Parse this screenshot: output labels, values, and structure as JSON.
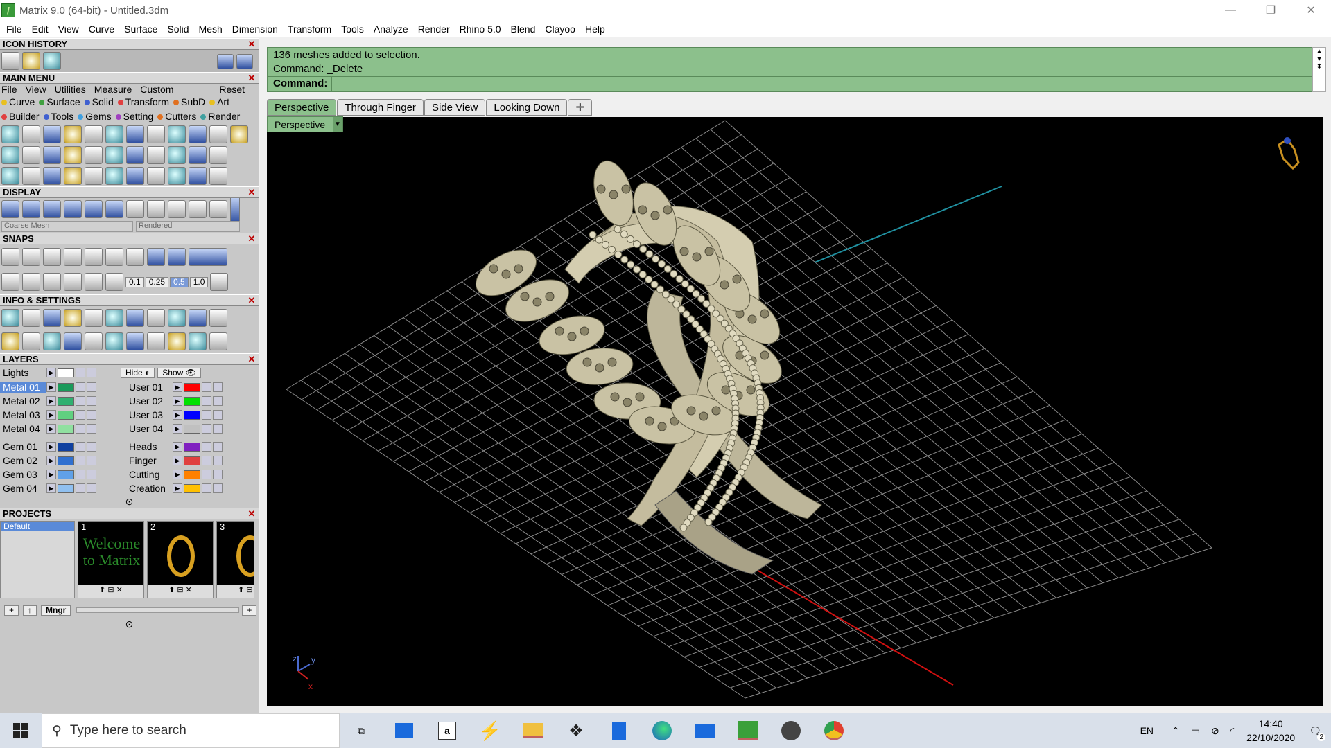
{
  "window": {
    "title": "Matrix 9.0 (64-bit) - Untitled.3dm"
  },
  "menu": [
    "File",
    "Edit",
    "View",
    "Curve",
    "Surface",
    "Solid",
    "Mesh",
    "Dimension",
    "Transform",
    "Tools",
    "Analyze",
    "Render",
    "Rhino 5.0",
    "Blend",
    "Clayoo",
    "Help"
  ],
  "panels": {
    "icon_history": "ICON HISTORY",
    "main_menu": "MAIN MENU",
    "display": "DISPLAY",
    "snaps": "SNAPS",
    "info": "INFO & SETTINGS",
    "layers": "LAYERS",
    "projects": "PROJECTS"
  },
  "main_menu": {
    "tabs": [
      "File",
      "View",
      "Utilities",
      "Measure",
      "Custom"
    ],
    "reset": "Reset",
    "row1": [
      {
        "label": "Curve",
        "color": "#e8c020"
      },
      {
        "label": "Surface",
        "color": "#40a040"
      },
      {
        "label": "Solid",
        "color": "#4060d0"
      },
      {
        "label": "Transform",
        "color": "#e04040"
      },
      {
        "label": "SubD",
        "color": "#e07020"
      },
      {
        "label": "Art",
        "color": "#e8c020"
      }
    ],
    "row2": [
      {
        "label": "Builder",
        "color": "#e04040"
      },
      {
        "label": "Tools",
        "color": "#4060d0"
      },
      {
        "label": "Gems",
        "color": "#40a0e0"
      },
      {
        "label": "Setting",
        "color": "#a040c0"
      },
      {
        "label": "Cutters",
        "color": "#e07020"
      },
      {
        "label": "Render",
        "color": "#40a0a0"
      }
    ]
  },
  "display": {
    "mesh_combo": "Coarse Mesh",
    "render_combo": "Rendered"
  },
  "snaps": {
    "values": [
      "0.1",
      "0.25",
      "0.5",
      "1.0"
    ]
  },
  "layers": {
    "lights": "Lights",
    "hide": "Hide",
    "show": "Show",
    "left": [
      {
        "name": "Metal 01",
        "color": "#1a9a5a",
        "selected": true
      },
      {
        "name": "Metal 02",
        "color": "#30b070"
      },
      {
        "name": "Metal 03",
        "color": "#60d080"
      },
      {
        "name": "Metal 04",
        "color": "#90e0a0"
      },
      {
        "name": "Gem 01",
        "color": "#1040a0"
      },
      {
        "name": "Gem 02",
        "color": "#3070d0"
      },
      {
        "name": "Gem 03",
        "color": "#60a0e8"
      },
      {
        "name": "Gem 04",
        "color": "#90c0f0"
      }
    ],
    "right": [
      {
        "name": "User 01",
        "color": "#ff0000"
      },
      {
        "name": "User 02",
        "color": "#00e000"
      },
      {
        "name": "User 03",
        "color": "#0000ff"
      },
      {
        "name": "User 04",
        "color": "#c0c0c0"
      },
      {
        "name": "Heads",
        "color": "#8020c0"
      },
      {
        "name": "Finger",
        "color": "#e04040"
      },
      {
        "name": "Cutting",
        "color": "#ff8000"
      },
      {
        "name": "Creation",
        "color": "#ffc000"
      }
    ]
  },
  "projects": {
    "list": [
      "Default"
    ],
    "thumbs": [
      {
        "num": "1",
        "text": "Welcome to Matrix"
      },
      {
        "num": "2",
        "text": ""
      },
      {
        "num": "3",
        "text": ""
      }
    ],
    "mngr": "Mngr"
  },
  "command": {
    "line1": "136 meshes added to selection.",
    "line2": "Command: _Delete",
    "prompt": "Command:"
  },
  "viewport_tabs": [
    "Perspective",
    "Through Finger",
    "Side View",
    "Looking Down"
  ],
  "viewport_combo": "Perspective",
  "axis": {
    "x": "x",
    "y": "y",
    "z": "z"
  },
  "taskbar": {
    "search": "Type here to search",
    "lang": "EN",
    "time": "14:40",
    "date": "22/10/2020",
    "notif": "2"
  }
}
